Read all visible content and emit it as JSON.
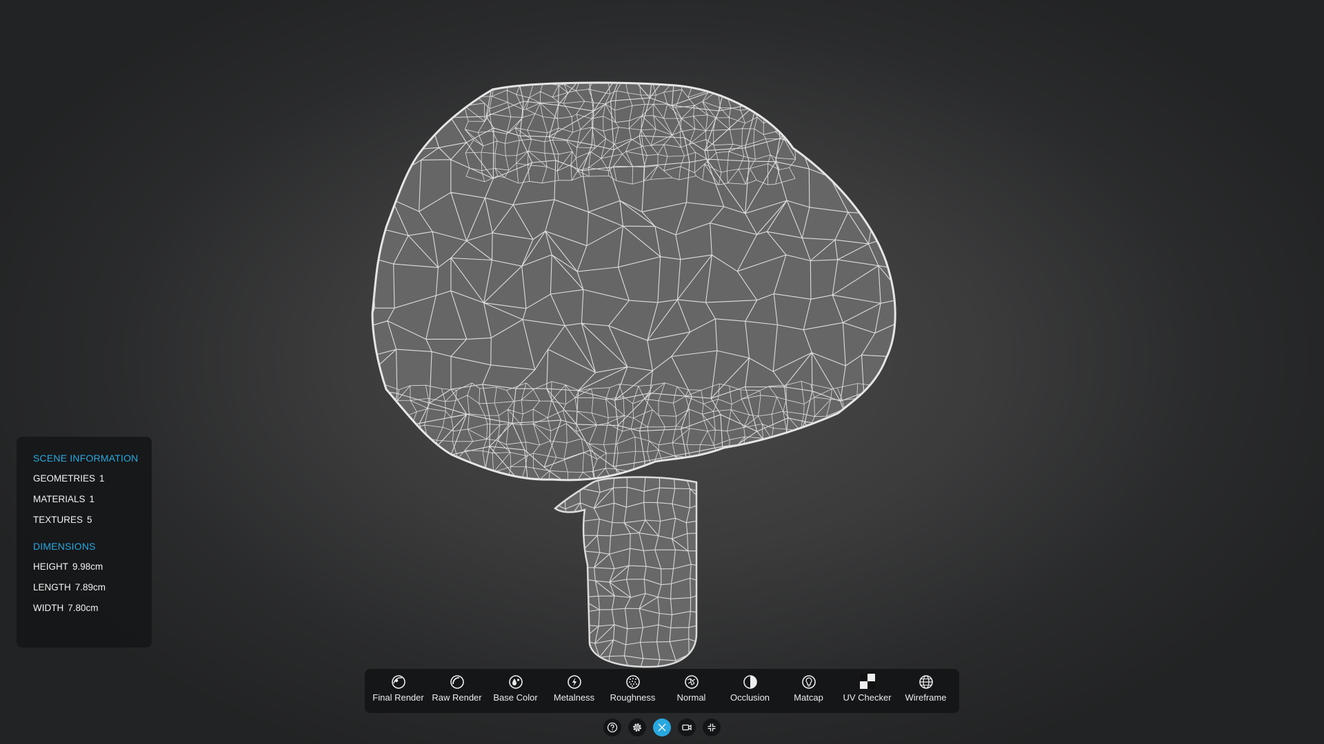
{
  "scene_info": {
    "title": "SCENE INFORMATION",
    "rows": [
      {
        "label": "GEOMETRIES",
        "value": "1"
      },
      {
        "label": "MATERIALS",
        "value": "1"
      },
      {
        "label": "TEXTURES",
        "value": "5"
      }
    ]
  },
  "dimensions": {
    "title": "DIMENSIONS",
    "rows": [
      {
        "label": "HEIGHT",
        "value": "9.98cm"
      },
      {
        "label": "LENGTH",
        "value": "7.89cm"
      },
      {
        "label": "WIDTH",
        "value": "7.80cm"
      }
    ]
  },
  "toolbar": {
    "items": [
      {
        "label": "Final Render",
        "icon": "final-render-icon"
      },
      {
        "label": "Raw Render",
        "icon": "raw-render-icon"
      },
      {
        "label": "Base Color",
        "icon": "base-color-icon"
      },
      {
        "label": "Metalness",
        "icon": "metalness-icon"
      },
      {
        "label": "Roughness",
        "icon": "roughness-icon"
      },
      {
        "label": "Normal",
        "icon": "normal-icon"
      },
      {
        "label": "Occlusion",
        "icon": "occlusion-icon"
      },
      {
        "label": "Matcap",
        "icon": "matcap-icon"
      },
      {
        "label": "UV Checker",
        "icon": "uv-checker-icon"
      },
      {
        "label": "Wireframe",
        "icon": "wireframe-icon"
      }
    ]
  },
  "controls": [
    {
      "icon": "help-icon",
      "active": false
    },
    {
      "icon": "gear-icon",
      "active": false
    },
    {
      "icon": "measure-icon",
      "active": true
    },
    {
      "icon": "camera-icon",
      "active": false
    },
    {
      "icon": "collapse-icon",
      "active": false
    }
  ],
  "colors": {
    "accent": "#29a8e0",
    "background": "#3b3b3c",
    "panel": "#161718",
    "mesh_fill": "#666666",
    "mesh_wire": "#e8e8e8"
  }
}
